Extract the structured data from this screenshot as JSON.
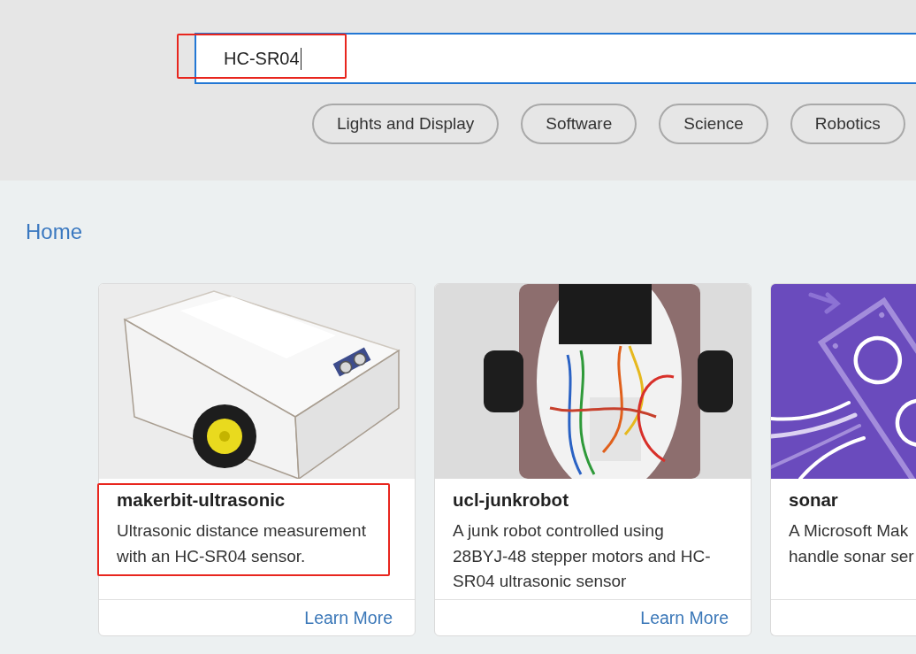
{
  "search": {
    "value": "HC-SR04",
    "focused": true,
    "highlighted": true
  },
  "categories": [
    "Lights and Display",
    "Software",
    "Science",
    "Robotics"
  ],
  "breadcrumb": "Home",
  "cards": [
    {
      "kind": "car",
      "title": "makerbit-ultrasonic",
      "description": [
        "Ultrasonic distance measurement",
        "with an HC-SR04 sensor."
      ],
      "link": "Learn More",
      "highlighted": true
    },
    {
      "kind": "chassis",
      "title": "ucl-junkrobot",
      "description": [
        "A junk robot controlled using",
        "28BYJ-48 stepper motors and HC-",
        "SR04 ultrasonic sensor"
      ],
      "link": "Learn More",
      "highlighted": false
    },
    {
      "kind": "sonar",
      "title": "sonar",
      "description": [
        "A Microsoft Mak",
        "handle sonar ser"
      ],
      "highlighted": false
    }
  ]
}
